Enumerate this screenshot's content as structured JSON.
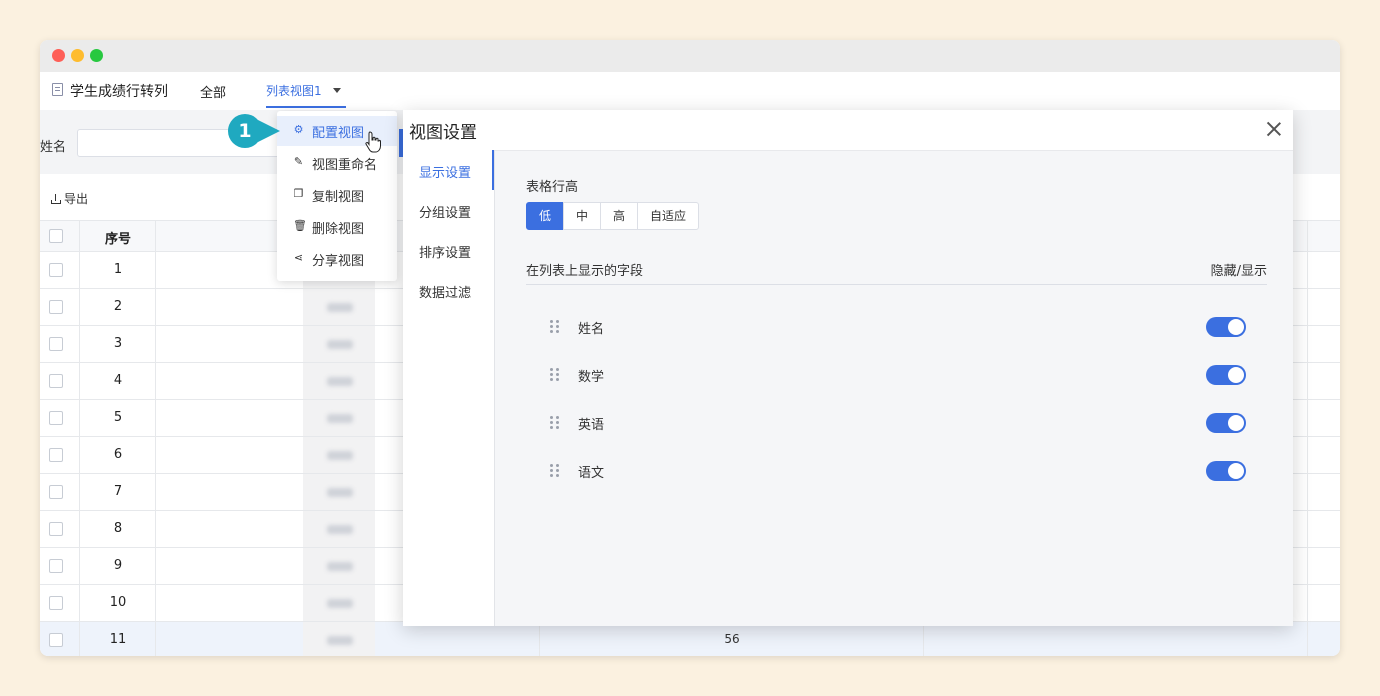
{
  "nav": {
    "title": "学生成绩行转列",
    "tabs": [
      "全部",
      "列表视图1"
    ]
  },
  "filter": {
    "name_label": "姓名"
  },
  "toolbar": {
    "export_label": "导出"
  },
  "table": {
    "header_seq": "序号",
    "rows": [
      "1",
      "2",
      "3",
      "4",
      "5",
      "6",
      "7",
      "8",
      "9",
      "10",
      "11"
    ],
    "row11_value": "56"
  },
  "menu": {
    "items": [
      {
        "label": "配置视图",
        "icon": "gear-icon"
      },
      {
        "label": "视图重命名",
        "icon": "edit-icon"
      },
      {
        "label": "复制视图",
        "icon": "copy-icon"
      },
      {
        "label": "删除视图",
        "icon": "trash-icon"
      },
      {
        "label": "分享视图",
        "icon": "share-icon"
      }
    ]
  },
  "callout": {
    "number": "1",
    "color": "#1fa9c0"
  },
  "dialog": {
    "title": "视图设置",
    "side": [
      "显示设置",
      "分组设置",
      "排序设置",
      "数据过滤"
    ],
    "row_height_label": "表格行高",
    "row_height_options": [
      "低",
      "中",
      "高",
      "自适应"
    ],
    "row_height_selected": "低",
    "fields_label": "在列表上显示的字段",
    "visibility_label": "隐藏/显示",
    "fields": [
      {
        "name": "姓名",
        "visible": true
      },
      {
        "name": "数学",
        "visible": true
      },
      {
        "name": "英语",
        "visible": true
      },
      {
        "name": "语文",
        "visible": true
      }
    ]
  },
  "colors": {
    "accent": "#3b6fe0",
    "background": "#fbf1e0"
  }
}
